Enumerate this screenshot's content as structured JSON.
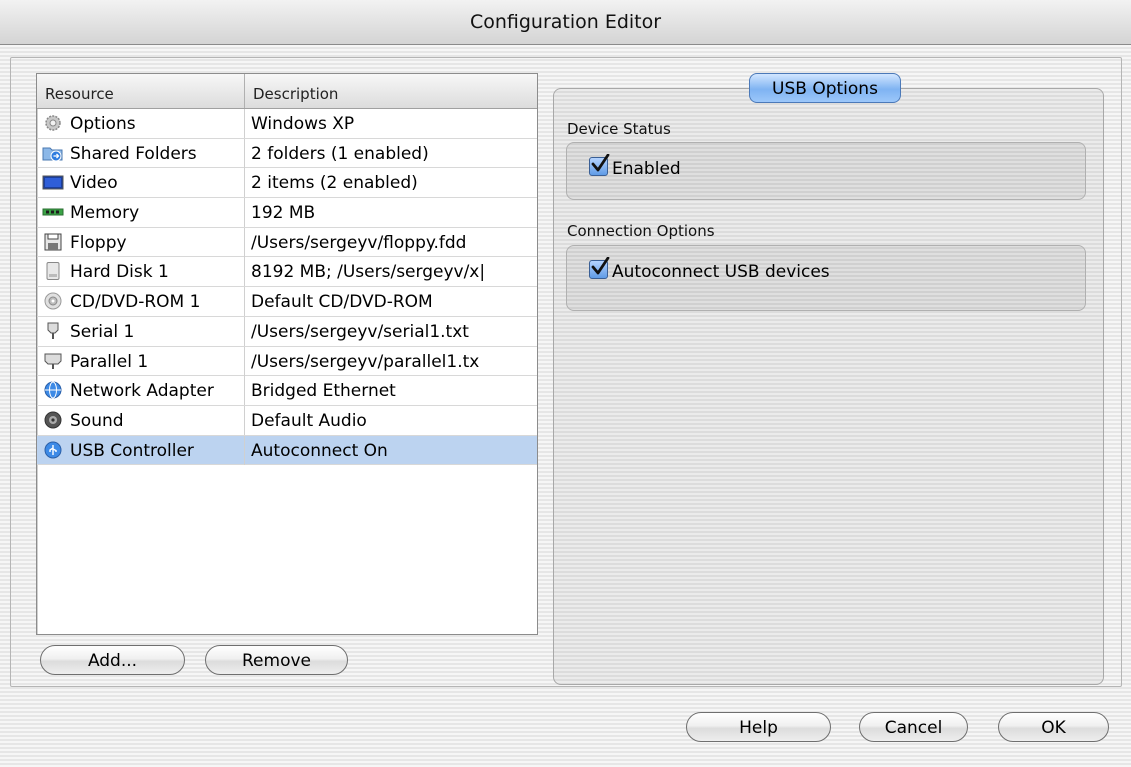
{
  "window": {
    "title": "Configuration Editor"
  },
  "table": {
    "headers": [
      "Resource",
      "Description"
    ],
    "rows": [
      {
        "resource": "Options",
        "description": "Windows XP",
        "icon": "gear-icon"
      },
      {
        "resource": "Shared Folders",
        "description": "2 folders (1 enabled)",
        "icon": "shared-folder-icon"
      },
      {
        "resource": "Video",
        "description": "2 items (2 enabled)",
        "icon": "monitor-icon"
      },
      {
        "resource": "Memory",
        "description": "192 MB",
        "icon": "memory-icon"
      },
      {
        "resource": "Floppy",
        "description": "/Users/sergeyv/floppy.fdd",
        "icon": "floppy-icon"
      },
      {
        "resource": "Hard Disk 1",
        "description": "8192 MB; /Users/sergeyv/x|",
        "icon": "hard-disk-icon"
      },
      {
        "resource": "CD/DVD-ROM 1",
        "description": "Default CD/DVD-ROM",
        "icon": "cd-icon"
      },
      {
        "resource": "Serial 1",
        "description": "/Users/sergeyv/serial1.txt",
        "icon": "serial-icon"
      },
      {
        "resource": "Parallel 1",
        "description": "/Users/sergeyv/parallel1.tx",
        "icon": "parallel-icon"
      },
      {
        "resource": "Network Adapter",
        "description": "Bridged Ethernet",
        "icon": "network-icon"
      },
      {
        "resource": "Sound",
        "description": "Default Audio",
        "icon": "speaker-icon"
      },
      {
        "resource": "USB Controller",
        "description": "Autoconnect On",
        "icon": "usb-icon",
        "selected": true
      }
    ]
  },
  "list_buttons": {
    "add": "Add...",
    "remove": "Remove"
  },
  "usb_panel": {
    "tab_label": "USB Options",
    "device_status_label": "Device Status",
    "enabled_label": "Enabled",
    "enabled_checked": true,
    "connection_options_label": "Connection Options",
    "autoconnect_label": "Autoconnect USB devices",
    "autoconnect_checked": true
  },
  "dialog_buttons": {
    "help": "Help",
    "cancel": "Cancel",
    "ok": "OK"
  },
  "colors": {
    "selection": "#bcd3f0",
    "tab_accent": "#7fb3f2",
    "checkbox_accent": "#5f9be6"
  }
}
